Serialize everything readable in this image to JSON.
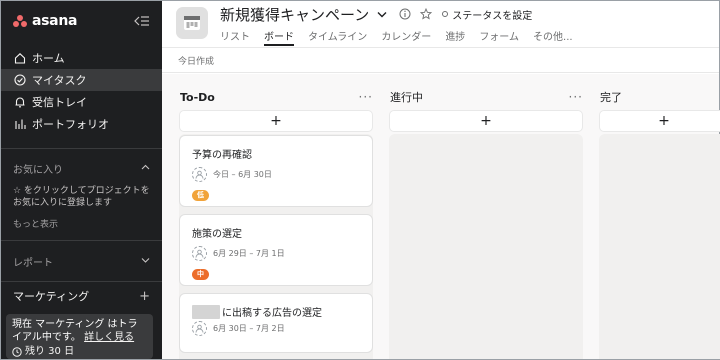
{
  "sidebar": {
    "logo": "asana",
    "nav": [
      {
        "label": "ホーム",
        "icon": "home-icon"
      },
      {
        "label": "マイタスク",
        "icon": "check-circle-icon"
      },
      {
        "label": "受信トレイ",
        "icon": "bell-icon"
      },
      {
        "label": "ポートフォリオ",
        "icon": "bar-chart-icon"
      }
    ],
    "favorites": {
      "title": "お気に入り",
      "hint": "☆ をクリックしてプロジェクトをお気に入りに登録します",
      "more": "もっと表示"
    },
    "reports": "レポート",
    "team": "マーケティング",
    "trial": {
      "text1": "現在 マーケティング はトライアル中です。",
      "link": "詳しく見る",
      "days": "残り 30 日"
    }
  },
  "header": {
    "title": "新規獲得キャンペーン",
    "status": "ステータスを設定",
    "tabs": [
      "リスト",
      "ボード",
      "タイムライン",
      "カレンダー",
      "進捗",
      "フォーム",
      "その他..."
    ],
    "active_tab": 1
  },
  "subbar": {
    "label": "今日作成"
  },
  "board": {
    "columns": [
      {
        "title": "To-Do",
        "cards": [
          {
            "title": "予算の再確認",
            "date": "今日 – 6月 30日",
            "priority": "低",
            "priority_color": "#f1a33a"
          },
          {
            "title": "施策の選定",
            "date": "6月 29日 – 7月 1日",
            "priority": "中",
            "priority_color": "#ec6d2a"
          },
          {
            "title": "に出稿する広告の選定",
            "date": "6月 30日 – 7月 2日",
            "priority": "",
            "priority_color": ""
          }
        ]
      },
      {
        "title": "進行中",
        "cards": []
      },
      {
        "title": "完了",
        "cards": []
      }
    ]
  },
  "colors": {
    "sidebar_bg": "#1e1f21",
    "logo_accent": "#f06a6a",
    "board_bg": "#f1f0ef"
  }
}
